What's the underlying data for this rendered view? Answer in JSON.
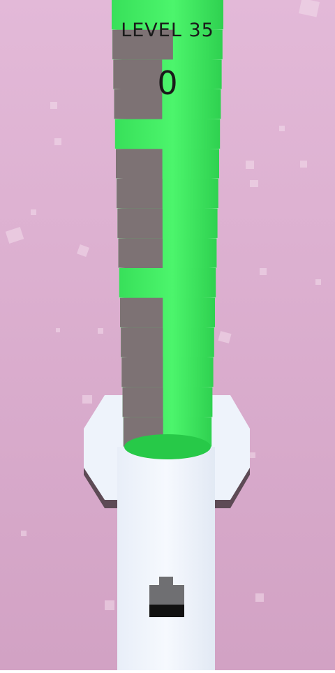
{
  "hud": {
    "level_label": "LEVEL 35",
    "score": "0"
  },
  "colors": {
    "background_top": "#e3b9d8",
    "background_bottom": "#d2a2c4",
    "block_green": "#46f266",
    "block_green_dark": "#27c948",
    "block_gray": "#7d7274",
    "pillar": "#eef3fb",
    "cannon": "#6f6f72"
  },
  "tower": {
    "top_segment_pattern": [
      "green",
      "green-gray",
      "gray-left",
      "gray-left",
      "green",
      "gray-left",
      "gray-left",
      "gray-left",
      "gray-left",
      "green",
      "gray-left",
      "gray-left",
      "gray-left",
      "gray-left",
      "gray-left"
    ]
  },
  "icons": {
    "cannon": "cannon-icon"
  }
}
